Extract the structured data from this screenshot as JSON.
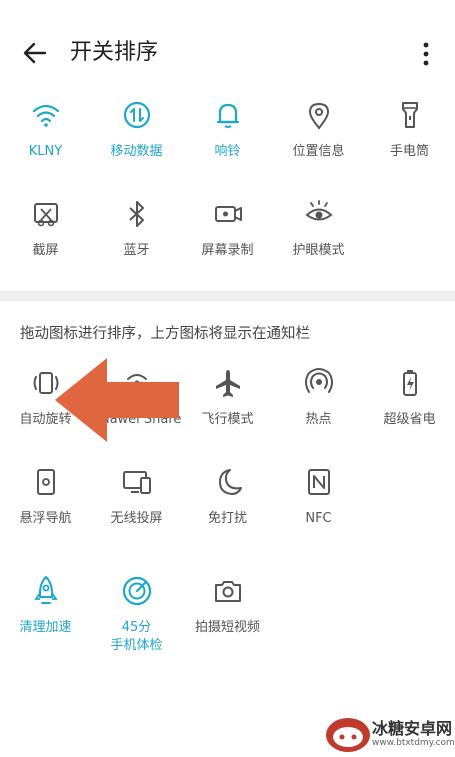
{
  "header": {
    "title": "开关排序"
  },
  "top_tiles": [
    {
      "label": "KLNY",
      "icon": "wifi-icon",
      "active": true
    },
    {
      "label": "移动数据",
      "icon": "mobile-data-icon",
      "active": true
    },
    {
      "label": "响铃",
      "icon": "bell-icon",
      "active": true
    },
    {
      "label": "位置信息",
      "icon": "location-icon",
      "active": false
    },
    {
      "label": "手电筒",
      "icon": "flashlight-icon",
      "active": false
    },
    {
      "label": "截屏",
      "icon": "screenshot-icon",
      "active": false
    },
    {
      "label": "蓝牙",
      "icon": "bluetooth-icon",
      "active": false
    },
    {
      "label": "屏幕录制",
      "icon": "screen-record-icon",
      "active": false
    },
    {
      "label": "护眼模式",
      "icon": "eye-comfort-icon",
      "active": false
    }
  ],
  "hint": "拖动图标进行排序，上方图标将显示在通知栏",
  "bottom_tiles": [
    {
      "label": "自动旋转",
      "icon": "auto-rotate-icon",
      "active": false
    },
    {
      "label": "Huawei Share",
      "icon": "huawei-share-icon",
      "active": false
    },
    {
      "label": "飞行模式",
      "icon": "airplane-icon",
      "active": false
    },
    {
      "label": "热点",
      "icon": "hotspot-icon",
      "active": false
    },
    {
      "label": "超级省电",
      "icon": "battery-saver-icon",
      "active": false
    },
    {
      "label": "悬浮导航",
      "icon": "floating-nav-icon",
      "active": false
    },
    {
      "label": "无线投屏",
      "icon": "wireless-projection-icon",
      "active": false
    },
    {
      "label": "免打扰",
      "icon": "moon-icon",
      "active": false
    },
    {
      "label": "NFC",
      "icon": "nfc-icon",
      "active": false
    },
    {
      "label": "清理加速",
      "icon": "rocket-icon",
      "active": true
    },
    {
      "label": "45分",
      "label2": "手机体检",
      "icon": "phone-checkup-icon",
      "active": true
    },
    {
      "label": "拍摄短视频",
      "icon": "camera-icon",
      "active": false
    }
  ],
  "watermark": {
    "name": "冰糖安卓网",
    "url": "www.btxtdmy.com"
  },
  "colors": {
    "active": "#1fa7c8",
    "inactive": "#555555",
    "arrow": "#e0663f"
  }
}
